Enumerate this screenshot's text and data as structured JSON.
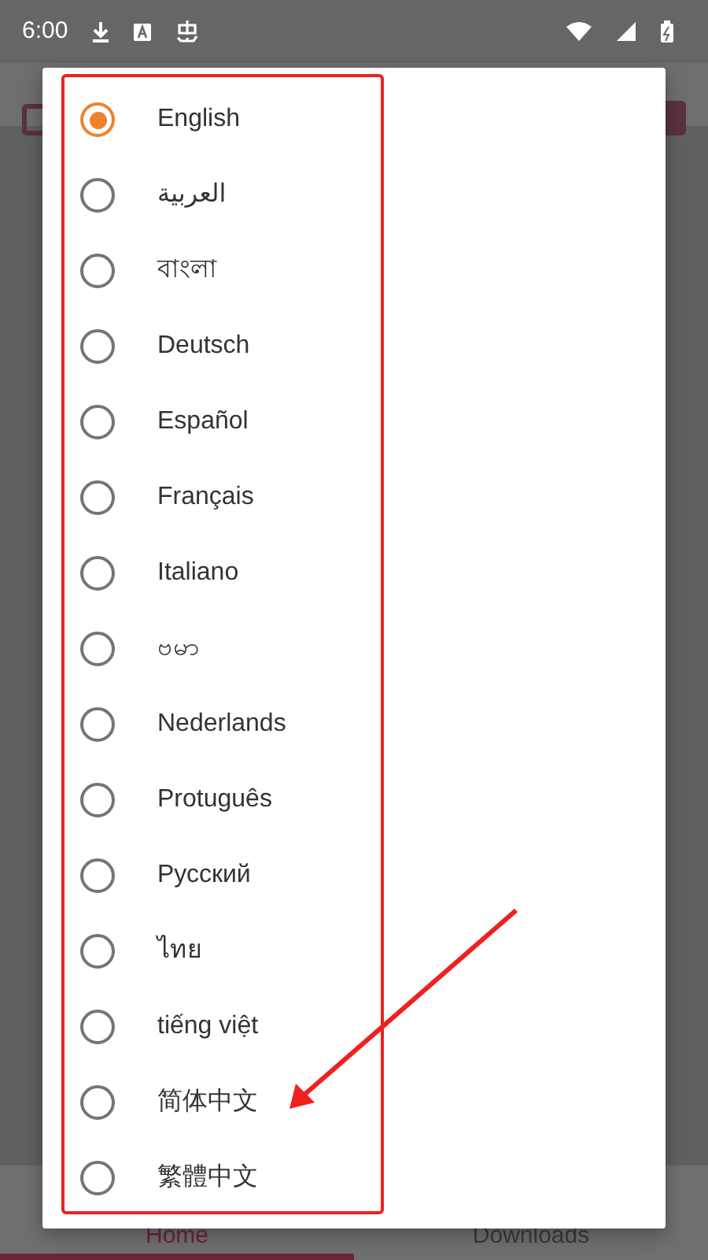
{
  "status_bar": {
    "time": "6:00"
  },
  "bottom_nav": [
    {
      "label": "Home",
      "selected": true
    },
    {
      "label": "Downloads",
      "selected": false
    }
  ],
  "language_dialog": {
    "options": [
      {
        "label": "English",
        "selected": true
      },
      {
        "label": "العربية",
        "selected": false
      },
      {
        "label": "বাংলা",
        "selected": false
      },
      {
        "label": "Deutsch",
        "selected": false
      },
      {
        "label": "Español",
        "selected": false
      },
      {
        "label": "Français",
        "selected": false
      },
      {
        "label": "Italiano",
        "selected": false
      },
      {
        "label": "ဗမာ",
        "selected": false
      },
      {
        "label": "Nederlands",
        "selected": false
      },
      {
        "label": "Protuguês",
        "selected": false
      },
      {
        "label": "Русский",
        "selected": false
      },
      {
        "label": "ไทย",
        "selected": false
      },
      {
        "label": "tiếng việt",
        "selected": false
      },
      {
        "label": "简体中文",
        "selected": false
      },
      {
        "label": "繁體中文",
        "selected": false
      }
    ]
  }
}
